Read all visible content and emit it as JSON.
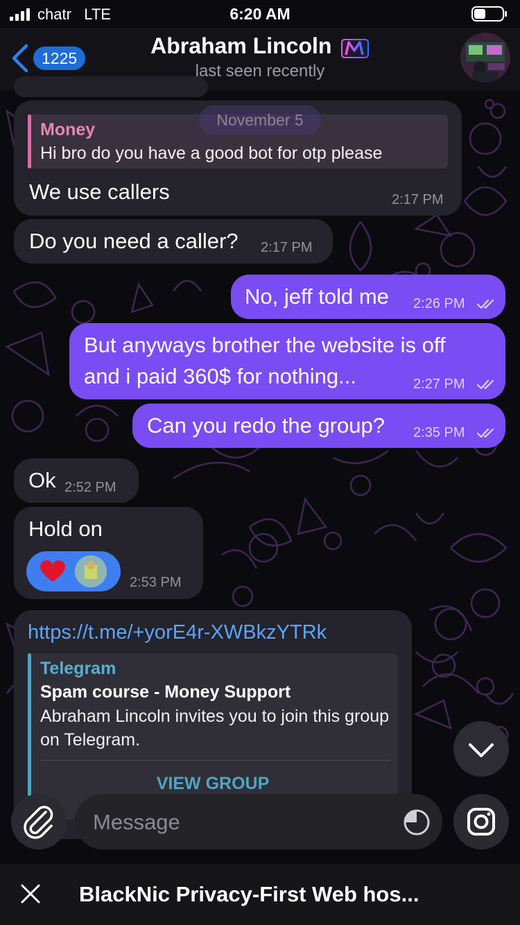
{
  "status_bar": {
    "carrier": "chatr",
    "network": "LTE",
    "time": "6:20 AM"
  },
  "header": {
    "back_count": "1225",
    "contact_name": "Abraham Lincoln",
    "status": "last seen recently"
  },
  "date_separator": "November 5",
  "messages": [
    {
      "reply_author": "Money",
      "reply_text": "Hi bro do you have a good bot for otp please",
      "text": "We use callers",
      "time": "2:17 PM"
    },
    {
      "text": "Do you need a caller?",
      "time": "2:17 PM"
    },
    {
      "text": "No, jeff told me",
      "time": "2:26 PM"
    },
    {
      "line1": "But anyways brother the website is off",
      "line2": "and i paid 360$ for nothing...",
      "time": "2:27 PM"
    },
    {
      "text": "Can you redo the group?",
      "time": "2:35 PM"
    },
    {
      "text": "Ok",
      "time": "2:52 PM"
    },
    {
      "text": "Hold on",
      "time": "2:53 PM",
      "reaction": "heart"
    },
    {
      "link": "https://t.me/+yorE4r-XWBkzYTRk",
      "preview": {
        "site": "Telegram",
        "title": "Spam course - Money Support",
        "description": "Abraham Lincoln invites you to join this group on Telegram.",
        "button": "VIEW GROUP"
      }
    }
  ],
  "composer": {
    "placeholder": "Message"
  },
  "sponsored": {
    "text": "BlackNic Privacy-First Web hos..."
  },
  "colors": {
    "outgoing": "#7a4cf3",
    "incoming": "#25232b",
    "link": "#5aa6ff",
    "accent": "#1e6dd8"
  },
  "icons": [
    "signal-icon",
    "battery-icon",
    "back-chevron-icon",
    "emoji-badge-icon",
    "avatar",
    "read-ticks-icon",
    "heart-icon",
    "chevron-down-icon",
    "paperclip-icon",
    "timer-icon",
    "instagram-icon",
    "close-icon"
  ]
}
